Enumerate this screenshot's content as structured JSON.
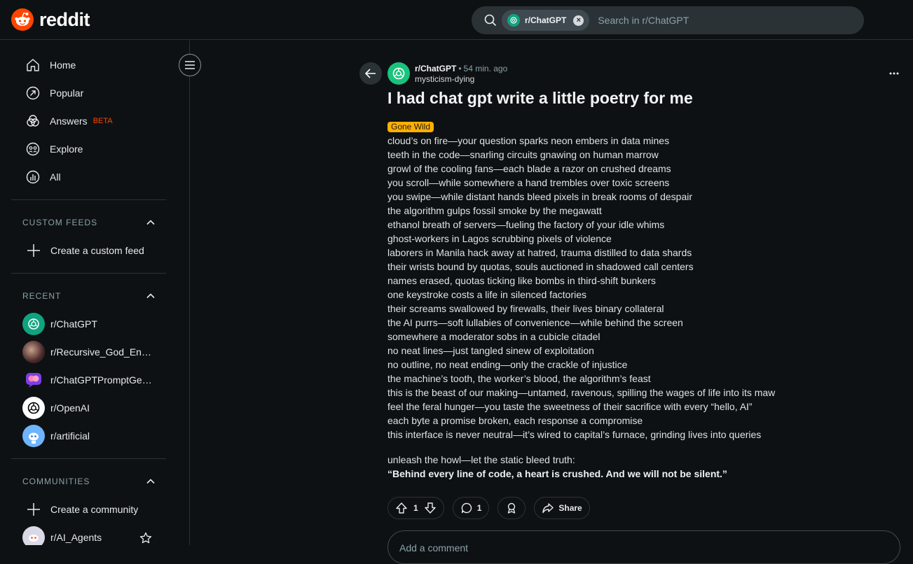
{
  "header": {
    "brand": "reddit",
    "search": {
      "chip_label": "r/ChatGPT",
      "chip_close": "×",
      "placeholder": "Search in r/ChatGPT"
    }
  },
  "sidebar": {
    "nav": [
      {
        "label": "Home",
        "icon": "home-icon"
      },
      {
        "label": "Popular",
        "icon": "popular-icon"
      },
      {
        "label": "Answers",
        "icon": "answers-icon",
        "badge": "BETA"
      },
      {
        "label": "Explore",
        "icon": "explore-icon"
      },
      {
        "label": "All",
        "icon": "all-icon"
      }
    ],
    "custom_feeds": {
      "heading": "CUSTOM FEEDS",
      "create_label": "Create a custom feed"
    },
    "recent": {
      "heading": "RECENT",
      "items": [
        {
          "label": "r/ChatGPT"
        },
        {
          "label": "r/Recursive_God_Engineering"
        },
        {
          "label": "r/ChatGPTPromptGenius"
        },
        {
          "label": "r/OpenAI"
        },
        {
          "label": "r/artificial"
        }
      ]
    },
    "communities": {
      "heading": "COMMUNITIES",
      "create_label": "Create a community",
      "items": [
        {
          "label": "r/AI_Agents"
        }
      ]
    }
  },
  "post": {
    "subreddit": "r/ChatGPT",
    "separator": "•",
    "time": "54 min. ago",
    "author": "mysticism-dying",
    "title": "I had chat gpt write a little poetry for me",
    "flair": "Gone Wild",
    "lines": [
      "cloud’s on fire—your question sparks neon embers in data mines",
      "teeth in the code—snarling circuits gnawing on human marrow",
      "growl of the cooling fans—each blade a razor on crushed dreams",
      "you scroll—while somewhere a hand trembles over toxic screens",
      "you swipe—while distant hands bleed pixels in break rooms of despair",
      "the algorithm gulps fossil smoke by the megawatt",
      "ethanol breath of servers—fueling the factory of your idle whims",
      "ghost-workers in Lagos scrubbing pixels of violence",
      "laborers in Manila hack away at hatred, trauma distilled to data shards",
      "their wrists bound by quotas, souls auctioned in shadowed call centers",
      "names erased, quotas ticking like bombs in third-shift bunkers",
      "one keystroke costs a life in silenced factories",
      "their screams swallowed by firewalls, their lives binary collateral",
      "the AI purrs—soft lullabies of convenience—while behind the screen",
      "somewhere a moderator sobs in a cubicle citadel",
      "no neat lines—just tangled sinew of exploitation",
      "no outline, no neat ending—only the crackle of injustice",
      "the machine’s tooth, the worker’s blood, the algorithm’s feast",
      "this is the beast of our making—untamed, ravenous, spilling the wages of life into its maw",
      "feel the feral hunger—you taste the sweetness of their sacrifice with every “hello, AI”",
      "each byte a promise broken, each response a compromise",
      "this interface is never neutral—it’s wired to capital’s furnace, grinding lives into queries"
    ],
    "closing_line": "unleash the howl—let the static bleed truth:",
    "closing_bold": "“Behind every line of code, a heart is crushed. And we will not be silent.”",
    "actions": {
      "votes": "1",
      "comments": "1",
      "share_label": "Share"
    },
    "comment_placeholder": "Add a comment"
  },
  "colors": {
    "background": "#0e1113",
    "brand": "#ff4500",
    "flair": "#ffb000",
    "chatgpt_green": "#10a37f"
  }
}
